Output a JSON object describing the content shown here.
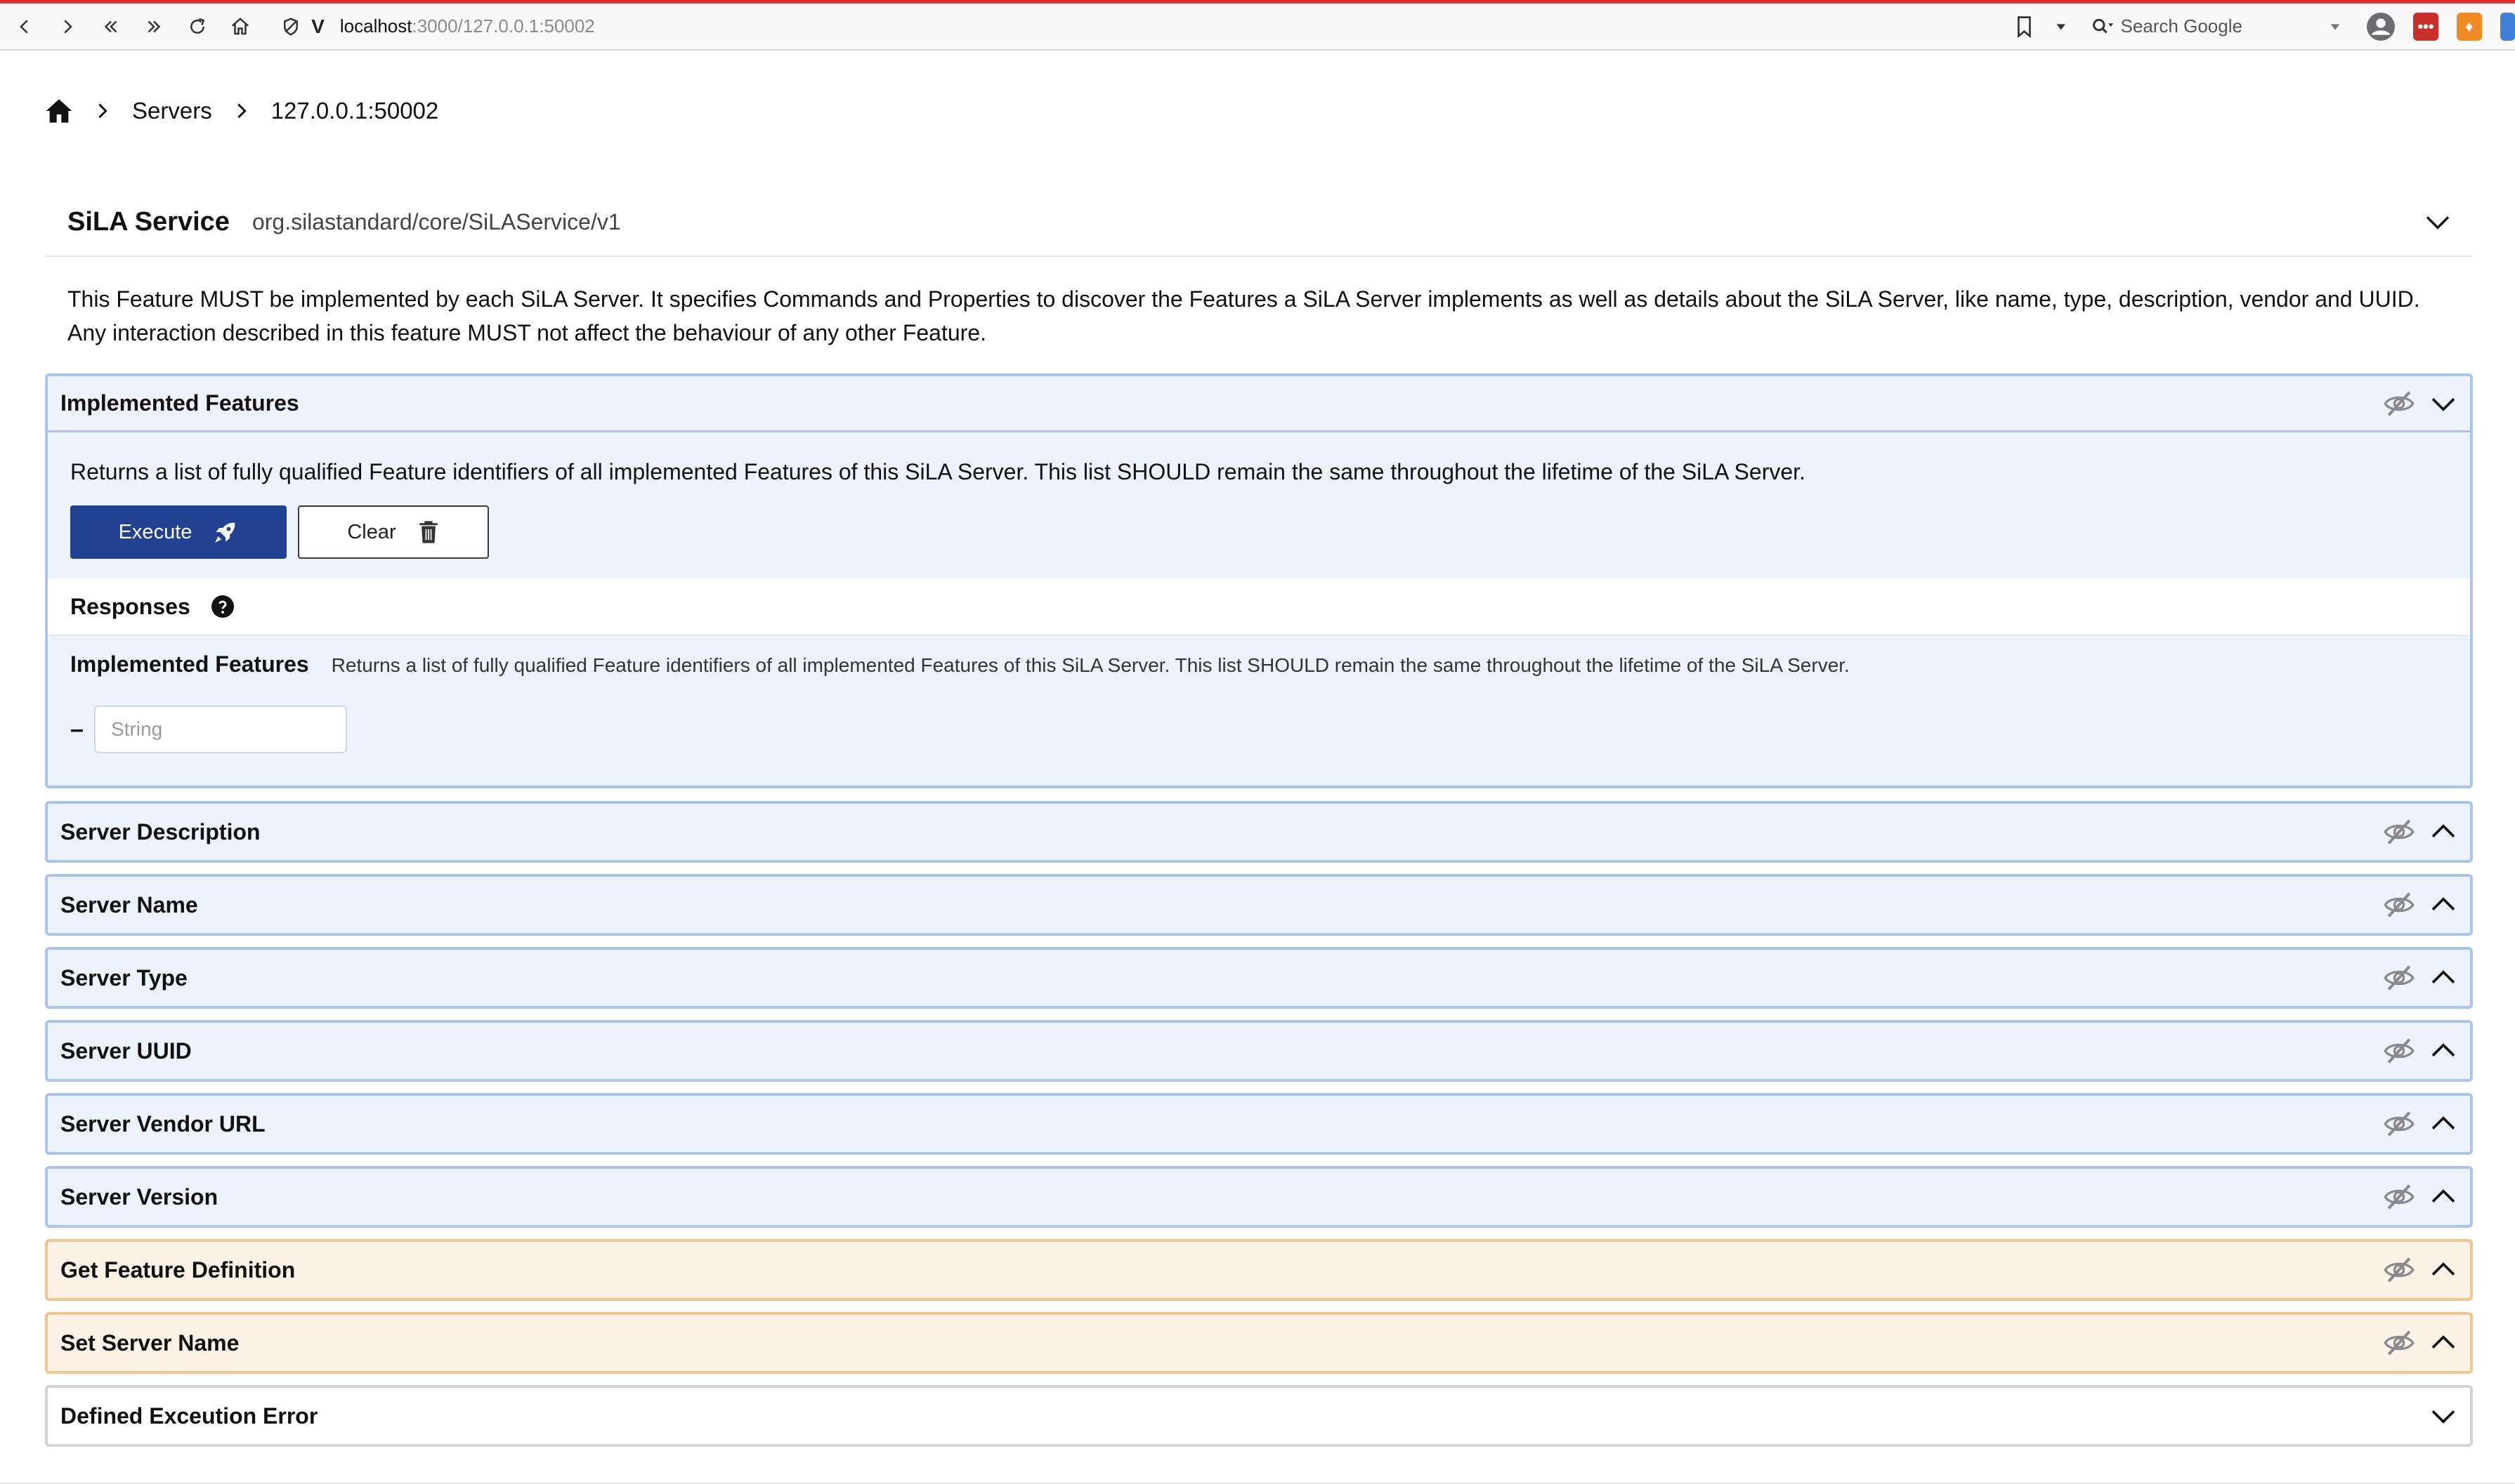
{
  "browser": {
    "url_host": "localhost",
    "url_path": ":3000/127.0.0.1:50002",
    "search_placeholder": "Search Google"
  },
  "breadcrumb": {
    "items": [
      "Servers",
      "127.0.0.1:50002"
    ]
  },
  "feature": {
    "title": "SiLA Service",
    "identifier": "org.silastandard/core/SiLAService/v1",
    "description_line1": "This Feature MUST be implemented by each SiLA Server. It specifies Commands and Properties to discover the Features a SiLA Server implements as well as details about the SiLA Server, like name, type, description, vendor and UUID.",
    "description_line2": "Any interaction described in this feature MUST not affect the behaviour of any other Feature."
  },
  "implemented_features": {
    "title": "Implemented Features",
    "description": "Returns a list of fully qualified Feature identifiers of all implemented Features of this SiLA Server. This list SHOULD remain the same throughout the lifetime of the SiLA Server.",
    "execute_label": "Execute",
    "clear_label": "Clear",
    "responses_label": "Responses",
    "response_name": "Implemented Features",
    "response_description": "Returns a list of fully qualified Feature identifiers of all implemented Features of this SiLA Server. This list SHOULD remain the same throughout the lifetime of the SiLA Server.",
    "string_placeholder": "String"
  },
  "panels": [
    {
      "title": "Server Description"
    },
    {
      "title": "Server Name"
    },
    {
      "title": "Server Type"
    },
    {
      "title": "Server UUID"
    },
    {
      "title": "Server Vendor URL"
    },
    {
      "title": "Server Version"
    },
    {
      "title": "Get Feature Definition"
    },
    {
      "title": "Set Server Name"
    },
    {
      "title": "Defined Exceution Error"
    }
  ],
  "colors": {
    "property_border": "#a9c5ef",
    "property_bg": "#edf3fc",
    "command_border": "#f6c58c",
    "command_bg": "#fdf2e6",
    "execute_button": "#21408f"
  }
}
